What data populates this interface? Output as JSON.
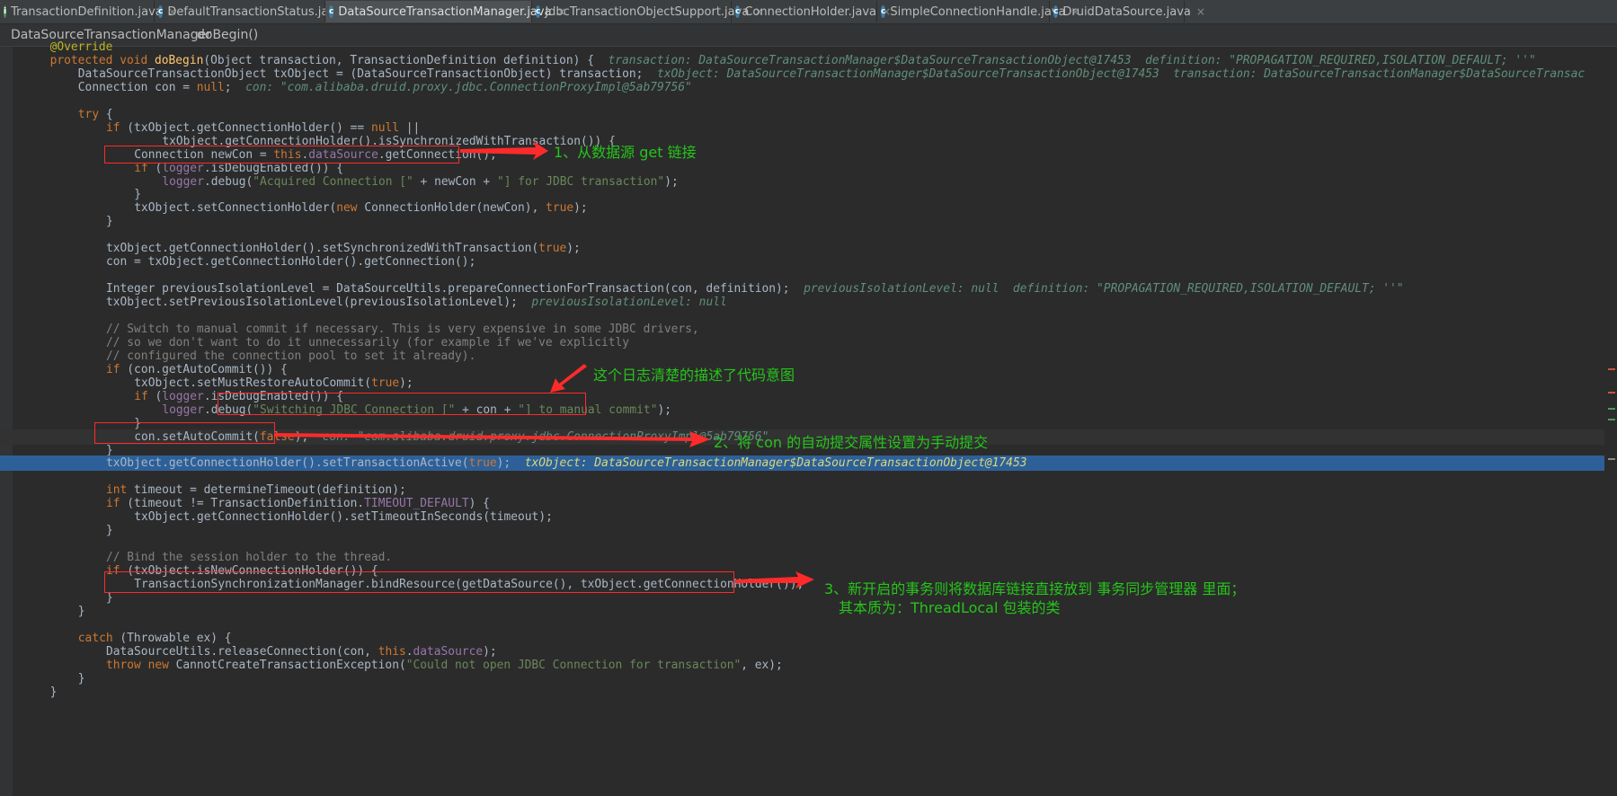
{
  "tabs": [
    {
      "label": "TransactionDefinition.java",
      "icon": "i",
      "color": "#4a9c52"
    },
    {
      "label": "DefaultTransactionStatus.java",
      "icon": "c",
      "color": "#3b7fa8"
    },
    {
      "label": "DataSourceTransactionManager.java",
      "icon": "c",
      "color": "#3b7fa8",
      "active": true
    },
    {
      "label": "JdbcTransactionObjectSupport.java",
      "icon": "c",
      "color": "#3b7fa8"
    },
    {
      "label": "ConnectionHolder.java",
      "icon": "c",
      "color": "#3b7fa8"
    },
    {
      "label": "SimpleConnectionHandle.java",
      "icon": "c",
      "color": "#3b7fa8"
    },
    {
      "label": "DruidDataSource.java",
      "icon": "c",
      "color": "#3b7fa8"
    }
  ],
  "close_glyph": "×",
  "breadcrumb": {
    "class": "DataSourceTransactionManager",
    "method": "doBegin()"
  },
  "code": [
    {
      "indent": 2,
      "segs": [
        [
          "@Override",
          "ann"
        ]
      ]
    },
    {
      "indent": 2,
      "segs": [
        [
          "protected void ",
          "kw"
        ],
        [
          "doBegin",
          "fn"
        ],
        [
          "(Object transaction, TransactionDefinition definition) {",
          ""
        ]
      ],
      "hint": "transaction: DataSourceTransactionManager$DataSourceTransactionObject@17453  definition: \"PROPAGATION_REQUIRED,ISOLATION_DEFAULT; ''\""
    },
    {
      "indent": 4,
      "segs": [
        [
          "DataSourceTransactionObject txObject = (DataSourceTransactionObject) transaction;",
          ""
        ]
      ],
      "hint": "txObject: DataSourceTransactionManager$DataSourceTransactionObject@17453  transaction: DataSourceTransactionManager$DataSourceTransac"
    },
    {
      "indent": 4,
      "segs": [
        [
          "Connection con = ",
          ""
        ],
        [
          "null",
          "kw"
        ],
        [
          ";",
          ""
        ]
      ],
      "hint": "con: \"com.alibaba.druid.proxy.jdbc.ConnectionProxyImpl@5ab79756\""
    },
    {
      "indent": 0,
      "segs": []
    },
    {
      "indent": 4,
      "segs": [
        [
          "try ",
          "kw"
        ],
        [
          "{",
          ""
        ]
      ]
    },
    {
      "indent": 6,
      "segs": [
        [
          "if ",
          "kw"
        ],
        [
          "(txObject.getConnectionHolder() == ",
          ""
        ],
        [
          "null",
          "kw"
        ],
        [
          " ||",
          ""
        ]
      ]
    },
    {
      "indent": 10,
      "segs": [
        [
          "txObject.getConnectionHolder().isSynchronizedWithTransaction()) {",
          ""
        ]
      ]
    },
    {
      "indent": 8,
      "segs": [
        [
          "Connection newCon = ",
          ""
        ],
        [
          "this",
          "kw"
        ],
        [
          ".",
          ""
        ],
        [
          "dataSource",
          "fld"
        ],
        [
          ".getConnection();",
          ""
        ]
      ]
    },
    {
      "indent": 8,
      "segs": [
        [
          "if ",
          "kw"
        ],
        [
          "(",
          ""
        ],
        [
          "logger",
          "fld"
        ],
        [
          ".isDebugEnabled()) {",
          ""
        ]
      ]
    },
    {
      "indent": 10,
      "segs": [
        [
          "logger",
          "fld"
        ],
        [
          ".debug(",
          ""
        ],
        [
          "\"Acquired Connection [\"",
          "str"
        ],
        [
          " + newCon + ",
          ""
        ],
        [
          "\"] for JDBC transaction\"",
          "str"
        ],
        [
          ");",
          ""
        ]
      ]
    },
    {
      "indent": 8,
      "segs": [
        [
          "}",
          ""
        ]
      ]
    },
    {
      "indent": 8,
      "segs": [
        [
          "txObject.setConnectionHolder(",
          ""
        ],
        [
          "new ",
          "kw"
        ],
        [
          "ConnectionHolder(newCon), ",
          ""
        ],
        [
          "true",
          "kw"
        ],
        [
          ");",
          ""
        ]
      ]
    },
    {
      "indent": 6,
      "segs": [
        [
          "}",
          ""
        ]
      ]
    },
    {
      "indent": 0,
      "segs": []
    },
    {
      "indent": 6,
      "segs": [
        [
          "txObject.getConnectionHolder().setSynchronizedWithTransaction(",
          ""
        ],
        [
          "true",
          "kw"
        ],
        [
          ");",
          ""
        ]
      ]
    },
    {
      "indent": 6,
      "segs": [
        [
          "con = txObject.getConnectionHolder().getConnection();",
          ""
        ]
      ]
    },
    {
      "indent": 0,
      "segs": []
    },
    {
      "indent": 6,
      "segs": [
        [
          "Integer previousIsolationLevel = DataSourceUtils.prepareConnectionForTransaction(con, definition);",
          ""
        ]
      ],
      "hint": "previousIsolationLevel: null  definition: \"PROPAGATION_REQUIRED,ISOLATION_DEFAULT; ''\""
    },
    {
      "indent": 6,
      "segs": [
        [
          "txObject.setPreviousIsolationLevel(previousIsolationLevel);",
          ""
        ]
      ],
      "hint": "previousIsolationLevel: null"
    },
    {
      "indent": 0,
      "segs": []
    },
    {
      "indent": 6,
      "segs": [
        [
          "// Switch to manual commit if necessary. This is very expensive in some JDBC drivers,",
          "cm"
        ]
      ]
    },
    {
      "indent": 6,
      "segs": [
        [
          "// so we don't want to do it unnecessarily (for example if we've explicitly",
          "cm"
        ]
      ]
    },
    {
      "indent": 6,
      "segs": [
        [
          "// configured the connection pool to set it already).",
          "cm"
        ]
      ]
    },
    {
      "indent": 6,
      "segs": [
        [
          "if ",
          "kw"
        ],
        [
          "(con.getAutoCommit()) {",
          ""
        ]
      ]
    },
    {
      "indent": 8,
      "segs": [
        [
          "txObject.setMustRestoreAutoCommit(",
          ""
        ],
        [
          "true",
          "kw"
        ],
        [
          ");",
          ""
        ]
      ]
    },
    {
      "indent": 8,
      "segs": [
        [
          "if ",
          "kw"
        ],
        [
          "(",
          ""
        ],
        [
          "logger",
          "fld"
        ],
        [
          ".isDebugEnabled()) {",
          ""
        ]
      ]
    },
    {
      "indent": 10,
      "segs": [
        [
          "logger",
          "fld"
        ],
        [
          ".debug(",
          ""
        ],
        [
          "\"Switching JDBC Connection [\"",
          "str"
        ],
        [
          " + con + ",
          ""
        ],
        [
          "\"] to manual commit\"",
          "str"
        ],
        [
          ");",
          ""
        ]
      ]
    },
    {
      "indent": 8,
      "segs": [
        [
          "}",
          ""
        ]
      ]
    },
    {
      "indent": 8,
      "segs": [
        [
          "con.setAutoCommit(",
          ""
        ],
        [
          "false",
          "kw"
        ],
        [
          ");",
          ""
        ]
      ],
      "hint": "con: \"com.alibaba.druid.proxy.jdbc.ConnectionProxyImpl@5ab79756\"",
      "cur": true
    },
    {
      "indent": 6,
      "segs": [
        [
          "}",
          ""
        ]
      ]
    },
    {
      "indent": 6,
      "segs": [
        [
          "txObject.getConnectionHolder().setTransactionActive(",
          ""
        ],
        [
          "true",
          "kw"
        ],
        [
          ");",
          ""
        ]
      ],
      "hint": "txObject: DataSourceTransactionManager$DataSourceTransactionObject@17453",
      "hl": true
    },
    {
      "indent": 0,
      "segs": []
    },
    {
      "indent": 6,
      "segs": [
        [
          "int ",
          "kw"
        ],
        [
          "timeout = determineTimeout(definition);",
          ""
        ]
      ]
    },
    {
      "indent": 6,
      "segs": [
        [
          "if ",
          "kw"
        ],
        [
          "(timeout != TransactionDefinition.",
          ""
        ],
        [
          "TIMEOUT_DEFAULT",
          "fld"
        ],
        [
          ") {",
          ""
        ]
      ]
    },
    {
      "indent": 8,
      "segs": [
        [
          "txObject.getConnectionHolder().setTimeoutInSeconds(timeout);",
          ""
        ]
      ]
    },
    {
      "indent": 6,
      "segs": [
        [
          "}",
          ""
        ]
      ]
    },
    {
      "indent": 0,
      "segs": []
    },
    {
      "indent": 6,
      "segs": [
        [
          "// Bind the session holder to the thread.",
          "cm"
        ]
      ]
    },
    {
      "indent": 6,
      "segs": [
        [
          "if ",
          "kw"
        ],
        [
          "(txObject.isNewConnectionHolder()) {",
          ""
        ]
      ]
    },
    {
      "indent": 8,
      "segs": [
        [
          "TransactionSynchronizationManager.bindResource(getDataSource(), txObject.getConnectionHolder());",
          ""
        ]
      ]
    },
    {
      "indent": 6,
      "segs": [
        [
          "}",
          ""
        ]
      ]
    },
    {
      "indent": 4,
      "segs": [
        [
          "}",
          ""
        ]
      ]
    },
    {
      "indent": 0,
      "segs": []
    },
    {
      "indent": 4,
      "segs": [
        [
          "catch ",
          "kw"
        ],
        [
          "(Throwable ex) {",
          ""
        ]
      ]
    },
    {
      "indent": 6,
      "segs": [
        [
          "DataSourceUtils.releaseConnection(con, ",
          ""
        ],
        [
          "this",
          "kw"
        ],
        [
          ".",
          ""
        ],
        [
          "dataSource",
          "fld"
        ],
        [
          ");",
          ""
        ]
      ]
    },
    {
      "indent": 6,
      "segs": [
        [
          "throw new ",
          "kw"
        ],
        [
          "CannotCreateTransactionException(",
          ""
        ],
        [
          "\"Could not open JDBC Connection for transaction\"",
          "str"
        ],
        [
          ", ex);",
          ""
        ]
      ]
    },
    {
      "indent": 4,
      "segs": [
        [
          "}",
          ""
        ]
      ]
    },
    {
      "indent": 2,
      "segs": [
        [
          "}",
          ""
        ]
      ]
    }
  ],
  "annotations": {
    "a1": "1、从数据源 get 链接",
    "a_log": "这个日志清楚的描述了代码意图",
    "a2": "2、将 con 的自动提交属性设置为手动提交",
    "a3_line1": "3、新开启的事务则将数据库链接直接放到  事务同步管理器  里面；",
    "a3_line2": "其本质为：ThreadLocal 包装的类"
  },
  "colors": {
    "annotation": "#26c41a",
    "box": "#ff2a2a",
    "highlight": "#2d6099",
    "background": "#2b2b2b"
  }
}
